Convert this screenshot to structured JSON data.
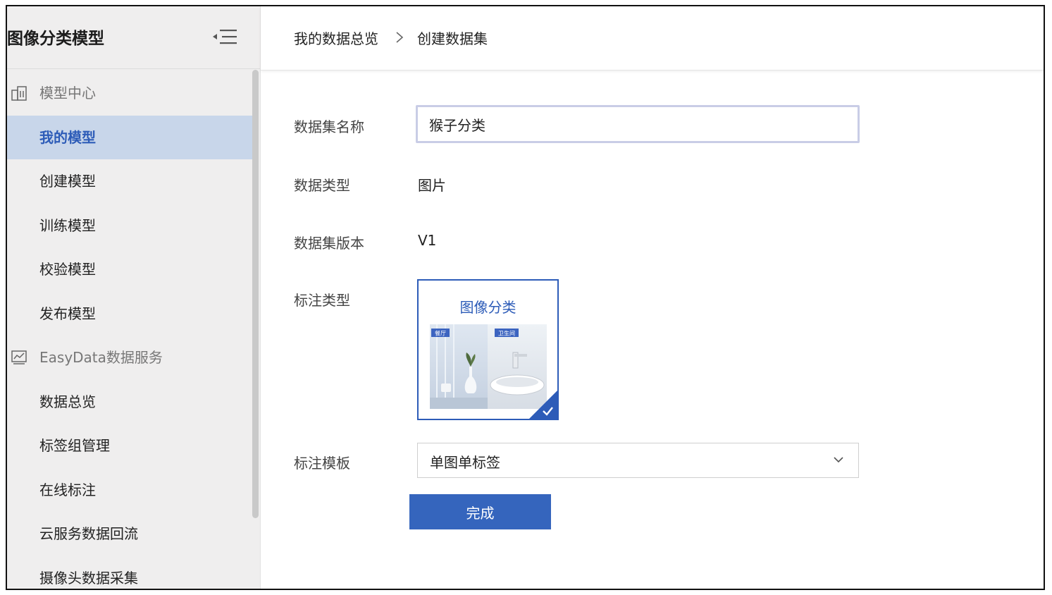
{
  "sidebar": {
    "title": "图像分类模型",
    "sections": [
      {
        "label": "模型中心",
        "icon": "building-icon",
        "items": [
          {
            "label": "我的模型",
            "active": true
          },
          {
            "label": "创建模型"
          },
          {
            "label": "训练模型"
          },
          {
            "label": "校验模型"
          },
          {
            "label": "发布模型"
          }
        ]
      },
      {
        "label": "EasyData数据服务",
        "icon": "chart-icon",
        "items": [
          {
            "label": "数据总览"
          },
          {
            "label": "标签组管理"
          },
          {
            "label": "在线标注"
          },
          {
            "label": "云服务数据回流"
          },
          {
            "label": "摄像头数据采集"
          }
        ]
      }
    ]
  },
  "breadcrumb": {
    "parent": "我的数据总览",
    "current": "创建数据集"
  },
  "form": {
    "name_label": "数据集名称",
    "name_value": "猴子分类",
    "type_label": "数据类型",
    "type_value": "图片",
    "version_label": "数据集版本",
    "version_value": "V1",
    "annotation_type_label": "标注类型",
    "annotation_card": {
      "title": "图像分类",
      "left_tag": "餐厅",
      "right_tag": "卫生间",
      "selected": true
    },
    "template_label": "标注模板",
    "template_value": "单图单标签",
    "submit_label": "完成"
  },
  "colors": {
    "accent": "#2d5cb8",
    "button": "#3565bd",
    "active_nav_bg": "#c8d6ea",
    "sidebar_bg": "#efeeee"
  }
}
